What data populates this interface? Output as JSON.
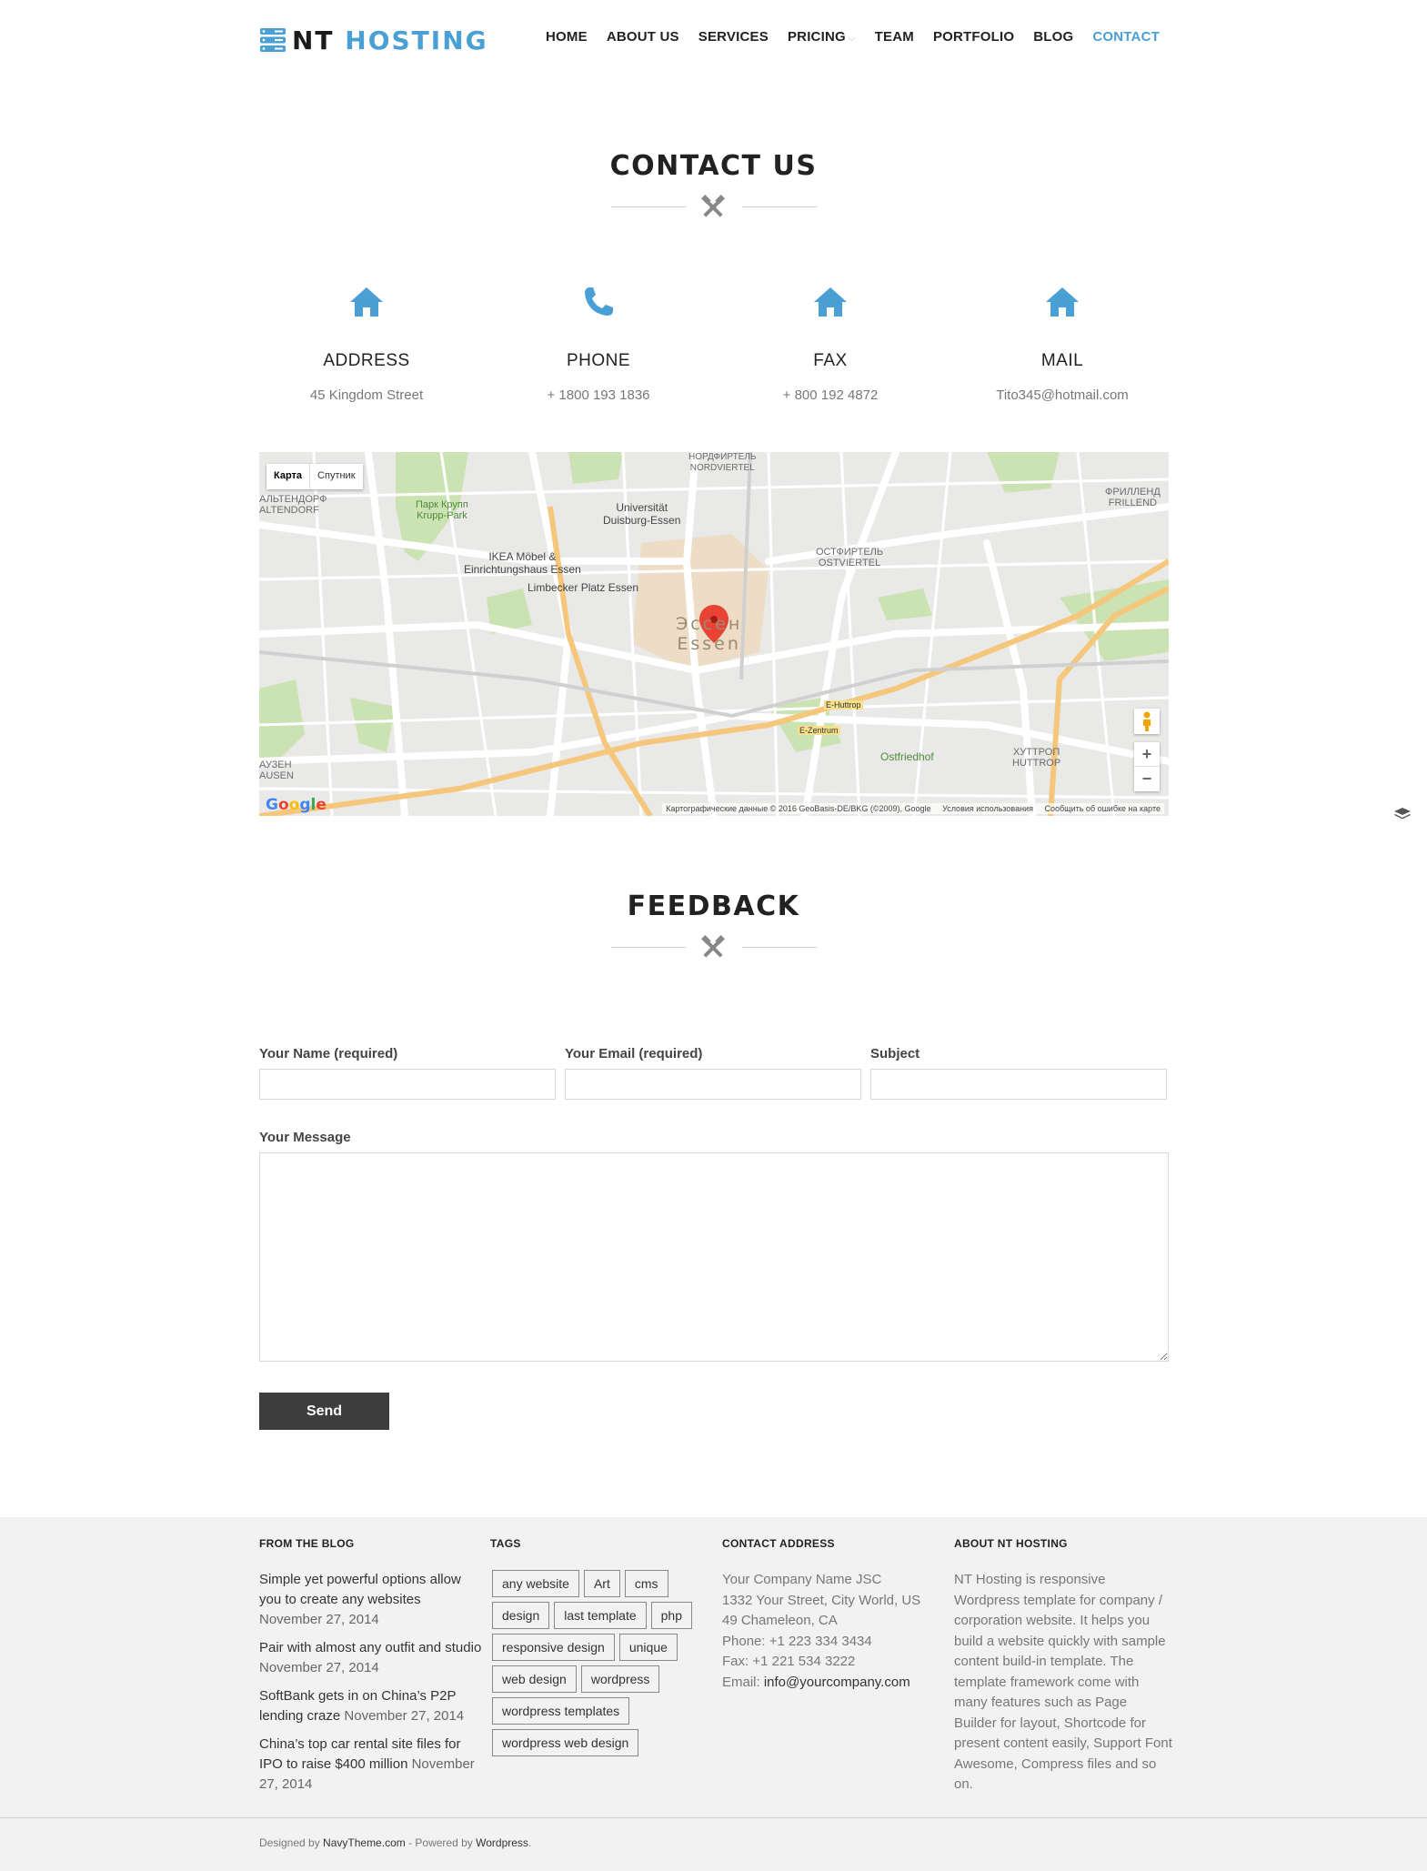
{
  "header": {
    "logo_main": "NT ",
    "logo_accent": "HOSTING",
    "nav": [
      {
        "label": "HOME"
      },
      {
        "label": "ABOUT US"
      },
      {
        "label": "SERVICES"
      },
      {
        "label": "PRICING"
      },
      {
        "label": "TEAM"
      },
      {
        "label": "PORTFOLIO"
      },
      {
        "label": "BLOG"
      },
      {
        "label": "CONTACT"
      }
    ],
    "active_color": "#4a9fd5"
  },
  "contact": {
    "title": "CONTACT US",
    "items": [
      {
        "icon": "home-icon",
        "label": "ADDRESS",
        "value": "45 Kingdom Street"
      },
      {
        "icon": "phone-icon",
        "label": "PHONE",
        "value": "+ 1800 193 1836"
      },
      {
        "icon": "home-icon",
        "label": "FAX",
        "value": "+ 800 192 4872"
      },
      {
        "icon": "home-icon",
        "label": "MAIL",
        "value": "Tito345@hotmail.com"
      }
    ]
  },
  "map": {
    "type_map": "Карта",
    "type_satellite": "Спутник",
    "city_ru": "Эссен",
    "city_de": "Essen",
    "labels": [
      "НОРДФИРТЕЛЬ",
      "NORDVIERTEL",
      "Парк Крупп",
      "Krupp-Park",
      "Universität",
      "Duisburg-Essen",
      "IKEA Möbel &",
      "Einrichtungshaus Essen",
      "Limbecker Platz Essen",
      "ОСТФИРТЕЛЬ",
      "OSTVIERTEL",
      "ФРИЛЛЕНД",
      "FRILLEND",
      "АЛЬТЕНДОРФ",
      "ALTENDORF",
      "Ostfriedhof",
      "ХУТТРОП",
      "HUTTROP",
      "АУЗЕН",
      "AUSEN",
      "E-Huttrop",
      "E-Zentrum"
    ],
    "zoom_in": "+",
    "zoom_out": "−",
    "attribution": "Картографические данные © 2016 GeoBasis-DE/BKG (©2009), Google",
    "terms": "Условия использования",
    "report": "Сообщить об ошибке на карте",
    "google_logo": "Google"
  },
  "feedback": {
    "title": "FEEDBACK",
    "name_label": "Your Name (required)",
    "email_label": "Your Email (required)",
    "subject_label": "Subject",
    "message_label": "Your Message",
    "name_value": "",
    "email_value": "",
    "subject_value": "",
    "message_value": "",
    "send_label": "Send"
  },
  "footer": {
    "blog_heading": "FROM THE BLOG",
    "posts": [
      {
        "title": "Simple yet powerful options allow you to create any websites",
        "date": "November 27, 2014"
      },
      {
        "title": "Pair with almost any outfit and studio",
        "date": "November 27, 2014"
      },
      {
        "title": "SoftBank gets in on China’s P2P lending craze",
        "date": "November 27, 2014"
      },
      {
        "title": "China’s top car rental site files for IPO to raise $400 million",
        "date": "November 27, 2014"
      }
    ],
    "tags_heading": "TAGS",
    "tags": [
      "any website",
      "Art",
      "cms",
      "design",
      "last template",
      "php",
      "responsive design",
      "unique",
      "web design",
      "wordpress",
      "wordpress templates",
      "wordpress web design"
    ],
    "contact_heading": "CONTACT ADDRESS",
    "contact_lines": [
      "Your Company Name JSC",
      "1332 Your Street, City World, US",
      "49 Chameleon, CA",
      "Phone: +1 223 334 3434",
      "Fax: +1 221 534 3222"
    ],
    "email_prefix": "Email: ",
    "email": "info@yourcompany.com",
    "about_heading": "ABOUT NT HOSTING",
    "about_text": "NT Hosting is responsive Wordpress template for company / corporation website. It helps you build a website quickly with sample content build-in template. The template framework come with many features such as Page Builder for layout, Shortcode for present content easily, Support Font Awesome, Compress files and so on.",
    "credit_prefix": "Designed by ",
    "credit_designer": "NavyTheme.com",
    "credit_mid": " - Powered by ",
    "credit_platform": "Wordpress",
    "credit_suffix": "."
  }
}
